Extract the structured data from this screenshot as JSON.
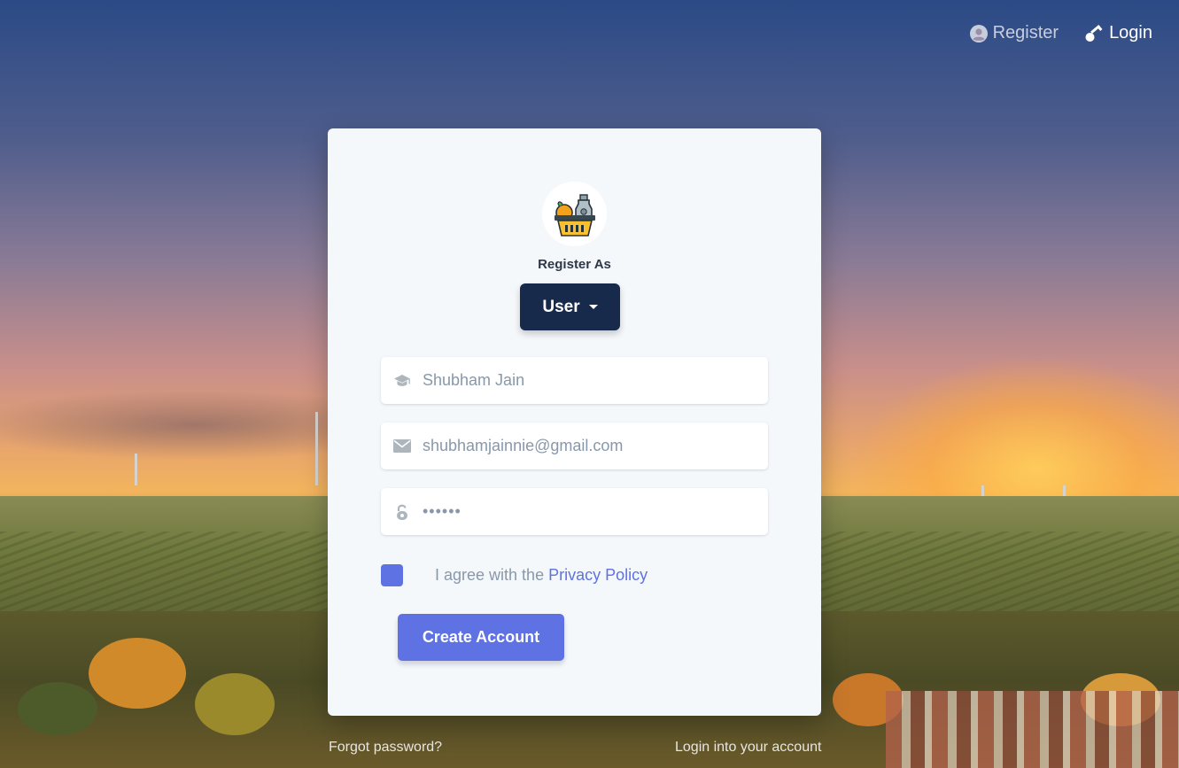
{
  "nav": {
    "register_label": "Register",
    "login_label": "Login"
  },
  "card": {
    "logo_icon": "grocery-basket-icon",
    "register_as_label": "Register As",
    "role_dropdown": {
      "selected": "User"
    },
    "fields": {
      "name": {
        "value": "Shubham Jain",
        "icon": "graduation-cap-icon"
      },
      "email": {
        "value": "shubhamjainnie@gmail.com",
        "icon": "envelope-icon"
      },
      "password": {
        "value": "••••••",
        "icon": "unlock-icon"
      }
    },
    "agree": {
      "prefix": "I agree with the",
      "link": "Privacy Policy",
      "checked": true
    },
    "submit_label": "Create Account"
  },
  "footer": {
    "forgot_password": "Forgot password?",
    "login_link": "Login into your account"
  },
  "colors": {
    "primary": "#5e72e4",
    "dropdown_bg": "#172a4b",
    "card_bg": "#f5f8fb",
    "muted_text": "#8898aa"
  }
}
